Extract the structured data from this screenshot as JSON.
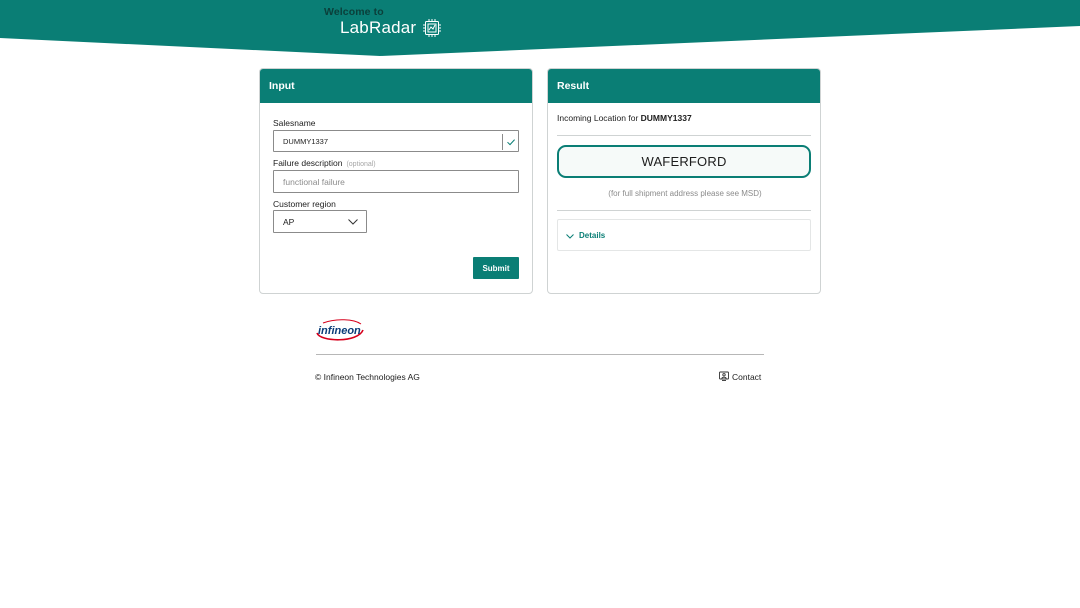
{
  "header": {
    "welcome": "Welcome to",
    "app_name": "LabRadar",
    "brand_color": "#0a7e75",
    "icon": "chip-icon"
  },
  "input_card": {
    "title": "Input",
    "salesname_label": "Salesname",
    "salesname_value": "DUMMY1337",
    "failure_label": "Failure description",
    "failure_optional": "(optional)",
    "failure_placeholder": "functional failure",
    "region_label": "Customer region",
    "region_value": "AP",
    "submit_label": "Submit"
  },
  "result_card": {
    "title": "Result",
    "incoming_prefix": "Incoming Location for",
    "incoming_salesname": "DUMMY1337",
    "location": "WAFERFORD",
    "note": "(for full shipment address please see MSD)",
    "details_label": "Details"
  },
  "footer": {
    "logo_text": "infineon",
    "copyright": "© Infineon Technologies AG",
    "contact_label": "Contact"
  }
}
